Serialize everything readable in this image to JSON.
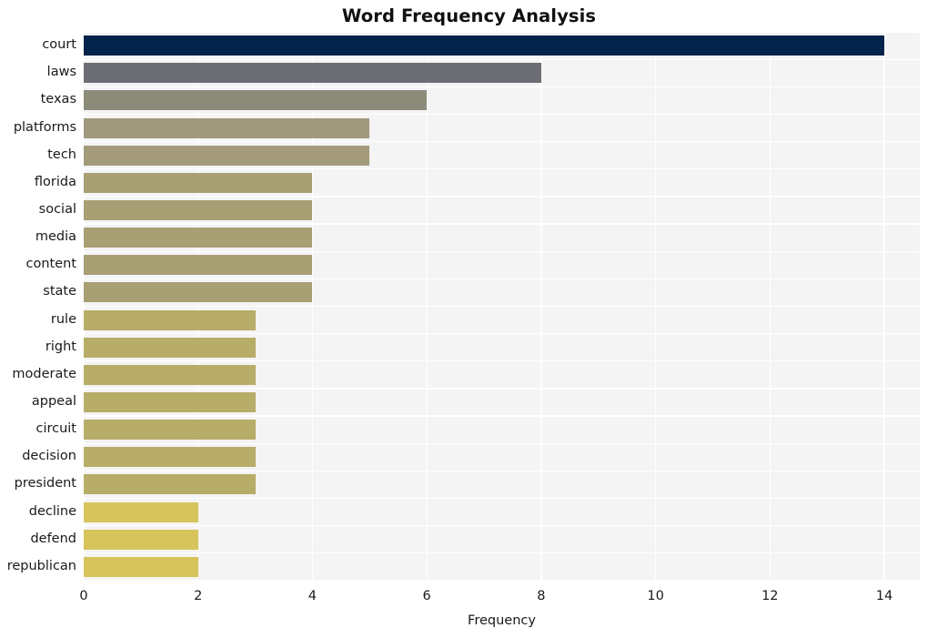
{
  "chart_data": {
    "type": "bar",
    "orientation": "horizontal",
    "title": "Word Frequency Analysis",
    "xlabel": "Frequency",
    "ylabel": "",
    "categories": [
      "court",
      "laws",
      "texas",
      "platforms",
      "tech",
      "florida",
      "social",
      "media",
      "content",
      "state",
      "rule",
      "right",
      "moderate",
      "appeal",
      "circuit",
      "decision",
      "president",
      "decline",
      "defend",
      "republican"
    ],
    "values": [
      14,
      8,
      6,
      5,
      5,
      4,
      4,
      4,
      4,
      4,
      3,
      3,
      3,
      3,
      3,
      3,
      3,
      2,
      2,
      2
    ],
    "bar_colors": [
      "#04234b",
      "#6d6e74",
      "#8c8a79",
      "#a0997d",
      "#a39b7a",
      "#a89f74",
      "#a89f74",
      "#a89f74",
      "#a89f74",
      "#a89f74",
      "#b7ac68",
      "#b7ac68",
      "#b7ac68",
      "#b7ac68",
      "#b7ac68",
      "#b7ac68",
      "#b7ac68",
      "#d7c45c",
      "#d7c45c",
      "#d7c45c"
    ],
    "xticks": [
      0,
      2,
      4,
      6,
      8,
      10,
      12,
      14
    ],
    "xtick_labels": [
      "0",
      "2",
      "4",
      "6",
      "8",
      "10",
      "12",
      "14"
    ],
    "xlim": [
      0,
      14.62
    ],
    "ylim_count": 20,
    "grid": "whitegrid",
    "plot_background": "#f4f4f5",
    "gridline_color": "#ffffff",
    "figure_background": "#ffffff",
    "legend": null
  }
}
